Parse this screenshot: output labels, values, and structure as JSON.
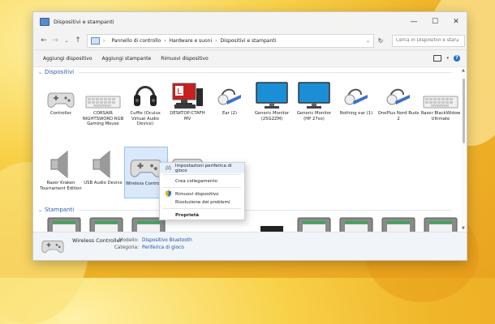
{
  "window": {
    "title": "Dispositivi e stampanti"
  },
  "nav": {
    "breadcrumb": [
      "Pannello di controllo",
      "Hardware e suoni",
      "Dispositivi e stampanti"
    ],
    "search_placeholder": "Cerca in Dispositivi e stamp..."
  },
  "commands": {
    "add_device": "Aggiungi dispositivo",
    "add_printer": "Aggiungi stampante",
    "remove_device": "Rimuovi dispositivo"
  },
  "sections": {
    "devices": "Dispositivi",
    "printers": "Stampanti"
  },
  "devices": [
    {
      "label": "Controller",
      "icon": "gamepad-icon"
    },
    {
      "label": "CORSAIR NIGHTSWORD RGB Gaming Mouse",
      "icon": "keyboard-icon"
    },
    {
      "label": "Cuffie (Oculus Virtual Audio Device)",
      "icon": "headphones-icon"
    },
    {
      "label": "DESKTOP-CTAFH MV",
      "icon": "computer-icon"
    },
    {
      "label": "Ear (2)",
      "icon": "earpiece-icon"
    },
    {
      "label": "Generic Monitor (25G2ZM)",
      "icon": "monitor-icon"
    },
    {
      "label": "Generic Monitor (HP 27es)",
      "icon": "monitor-icon"
    },
    {
      "label": "Nothing ear (1)",
      "icon": "earpiece-icon"
    },
    {
      "label": "OnePlus Nord Buds 2",
      "icon": "earpiece-icon"
    },
    {
      "label": "Razer BlackWidow Ultimate",
      "icon": "keyboard-icon"
    },
    {
      "label": "Razer Kraken Tournament Edition",
      "icon": "speaker-icon"
    },
    {
      "label": "USB Audio Device",
      "icon": "speaker-icon"
    },
    {
      "label": "Wireless Controller",
      "icon": "gamepad-icon"
    },
    {
      "label": "",
      "icon": "gamepad-icon"
    }
  ],
  "context_menu": {
    "items": [
      {
        "label": "Impostazioni periferica di gioco",
        "icon": "gamepad-small-icon"
      },
      {
        "label": "Crea collegamento",
        "icon": ""
      },
      {
        "label": "Rimuovi dispositivo",
        "icon": "shield-icon"
      },
      {
        "label": "Risoluzione dei problemi",
        "icon": ""
      },
      {
        "label": "Proprietà",
        "icon": ""
      }
    ]
  },
  "details": {
    "name": "Wireless Controller",
    "model_label": "Modello:",
    "model_value": "Dispositivo Bluetooth",
    "category_label": "Categoria:",
    "category_value": "Periferica di gioco"
  }
}
